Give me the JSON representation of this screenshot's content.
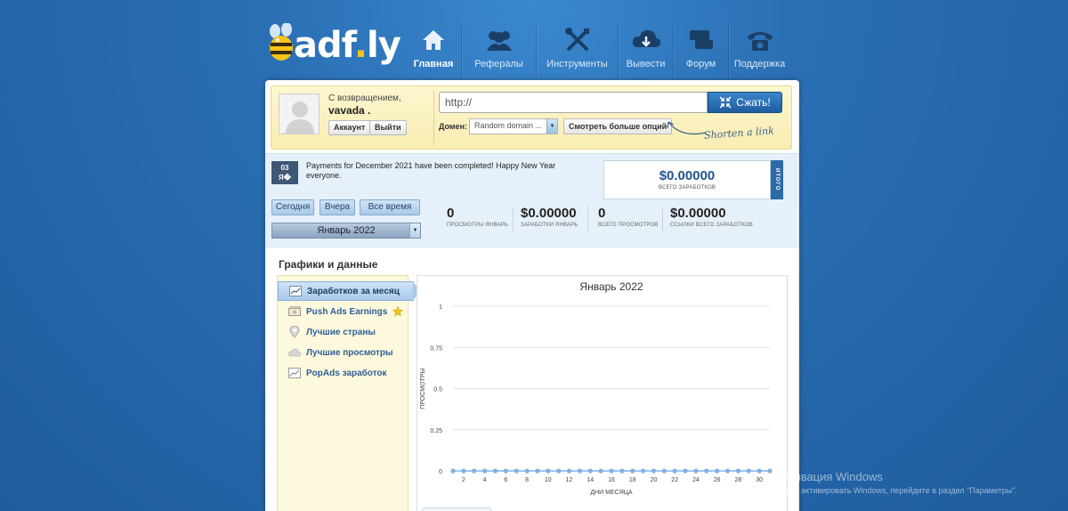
{
  "logo": {
    "text_main": "adf",
    "text_dot": ".",
    "text_end": "ly"
  },
  "nav": [
    {
      "label": "Главная",
      "icon": "home-icon",
      "active": true
    },
    {
      "label": "Рефералы",
      "icon": "users-icon",
      "active": false
    },
    {
      "label": "Инструменты",
      "icon": "tools-icon",
      "active": false
    },
    {
      "label": "Вывести",
      "icon": "cloud-download-icon",
      "active": false
    },
    {
      "label": "Форум",
      "icon": "chat-icon",
      "active": false
    },
    {
      "label": "Поддержка",
      "icon": "phone-icon",
      "active": false
    }
  ],
  "user": {
    "welcome": "С возвращением,",
    "name": "vavada .",
    "account_label": "Аккаунт",
    "logout_label": "Выйти"
  },
  "shortener": {
    "url_value": "http://",
    "shorten_label": "Сжать!",
    "domain_label": "Домен:",
    "domain_value": "Random domain ...",
    "more_options_label": "Смотреть больше опций",
    "hint": "Shorten a link"
  },
  "news": {
    "day": "03",
    "month": "Я�",
    "text": "Payments for December 2021 have been completed! Happy New Year everyone."
  },
  "totals": {
    "value": "$0.00000",
    "label": "ВСЕГО ЗАРАБОТКОВ",
    "tab": "ИТОГО"
  },
  "periods": {
    "today": "Сегодня",
    "yesterday": "Вчера",
    "all_time": "Все время",
    "month": "Январь 2022"
  },
  "stats": [
    {
      "value": "0",
      "label": "ПРОСМОТРЫ ЯНВАРЬ"
    },
    {
      "value": "$0.00000",
      "label": "ЗАРАБОТКИ ЯНВАРЬ"
    },
    {
      "value": "0",
      "label": "ВСЕГО ПРОСМОТРОВ"
    },
    {
      "value": "$0.00000",
      "label": "ССЫЛКИ ВСЕГО ЗАРАБОТКОВ"
    }
  ],
  "charts_section": {
    "title": "Графики и данные",
    "menu": [
      {
        "label": "Заработков за месяц",
        "icon": "chart-icon",
        "active": true
      },
      {
        "label": "Push Ads Earnings",
        "icon": "money-icon",
        "active": false,
        "star": true
      },
      {
        "label": "Лучшие страны",
        "icon": "map-pin-icon",
        "active": false
      },
      {
        "label": "Лучшие просмотры",
        "icon": "cloud-icon",
        "active": false
      },
      {
        "label": "PopAds заработок",
        "icon": "chart-icon",
        "active": false
      }
    ]
  },
  "chart_data": {
    "type": "line",
    "title": "Январь 2022",
    "xlabel": "ДНИ МЕСЯЦА",
    "ylabel": "ПРОСМОТРЫ",
    "xlim": [
      1,
      31
    ],
    "ylim": [
      0,
      1
    ],
    "yticks": [
      "0",
      "0.25",
      "0.5",
      "0.75",
      "1"
    ],
    "xticks": [
      "2",
      "4",
      "6",
      "8",
      "10",
      "12",
      "14",
      "16",
      "18",
      "20",
      "22",
      "24",
      "26",
      "28",
      "30"
    ],
    "grid": true,
    "series": [
      {
        "color": "#7fb2e5",
        "x": [
          1,
          2,
          3,
          4,
          5,
          6,
          7,
          8,
          9,
          10,
          11,
          12,
          13,
          14,
          15,
          16,
          17,
          18,
          19,
          20,
          21,
          22,
          23,
          24,
          25,
          26,
          27,
          28,
          29,
          30,
          31
        ],
        "y": [
          0,
          0,
          0,
          0,
          0,
          0,
          0,
          0,
          0,
          0,
          0,
          0,
          0,
          0,
          0,
          0,
          0,
          0,
          0,
          0,
          0,
          0,
          0,
          0,
          0,
          0,
          0,
          0,
          0,
          0,
          0
        ]
      }
    ]
  },
  "watermark": {
    "title": "Активация Windows",
    "subtitle": "Чтобы активировать Windows, перейдите в раздел \"Параметры\"."
  }
}
